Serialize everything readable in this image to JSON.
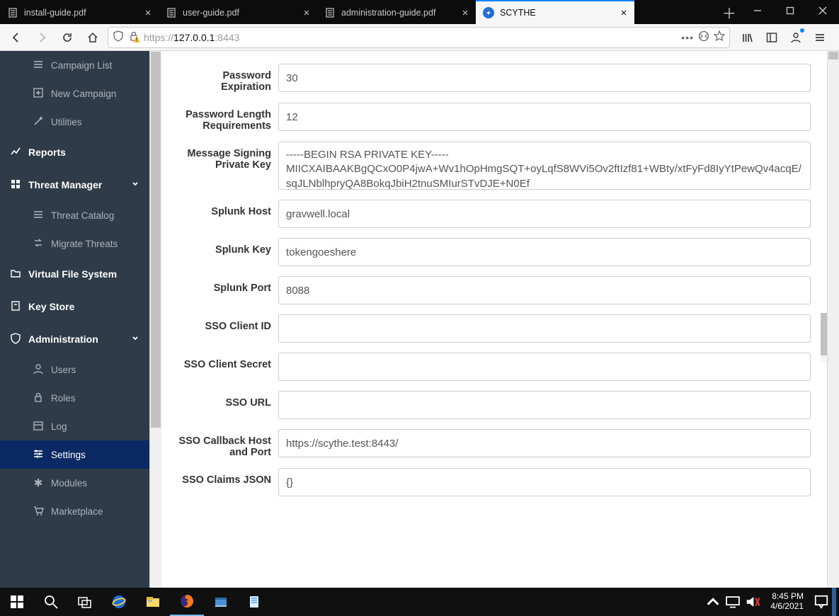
{
  "browser": {
    "tabs": [
      {
        "label": "install-guide.pdf",
        "active": false,
        "favicon": "pdf"
      },
      {
        "label": "user-guide.pdf",
        "active": false,
        "favicon": "pdf"
      },
      {
        "label": "administration-guide.pdf",
        "active": false,
        "favicon": "pdf"
      },
      {
        "label": "SCYTHE",
        "active": true,
        "favicon": "scythe"
      }
    ],
    "url": {
      "scheme": "https://",
      "host": "127.0.0.1",
      "port": ":8443"
    }
  },
  "sidebar": {
    "groups": [
      {
        "type": "sub",
        "icon": "list",
        "label": "Campaign List",
        "name": "sidebar-item-campaign-list"
      },
      {
        "type": "sub",
        "icon": "plus",
        "label": "New Campaign",
        "name": "sidebar-item-new-campaign"
      },
      {
        "type": "sub",
        "icon": "wand",
        "label": "Utilities",
        "name": "sidebar-item-utilities"
      },
      {
        "type": "header",
        "icon": "chart",
        "label": "Reports",
        "name": "sidebar-item-reports"
      },
      {
        "type": "header",
        "icon": "grid",
        "label": "Threat Manager",
        "name": "sidebar-item-threat-manager",
        "chevron": true
      },
      {
        "type": "sub",
        "icon": "list",
        "label": "Threat Catalog",
        "name": "sidebar-item-threat-catalog"
      },
      {
        "type": "sub",
        "icon": "swap",
        "label": "Migrate Threats",
        "name": "sidebar-item-migrate-threats"
      },
      {
        "type": "header",
        "icon": "folder",
        "label": "Virtual File System",
        "name": "sidebar-item-vfs"
      },
      {
        "type": "header",
        "icon": "box",
        "label": "Key Store",
        "name": "sidebar-item-keystore"
      },
      {
        "type": "header",
        "icon": "shield",
        "label": "Administration",
        "name": "sidebar-item-administration",
        "chevron": true
      },
      {
        "type": "sub",
        "icon": "user",
        "label": "Users",
        "name": "sidebar-item-users"
      },
      {
        "type": "sub",
        "icon": "lock",
        "label": "Roles",
        "name": "sidebar-item-roles"
      },
      {
        "type": "sub",
        "icon": "calendar",
        "label": "Log",
        "name": "sidebar-item-log"
      },
      {
        "type": "sub",
        "icon": "sliders",
        "label": "Settings",
        "name": "sidebar-item-settings",
        "active": true
      },
      {
        "type": "sub",
        "icon": "gear",
        "label": "Modules",
        "name": "sidebar-item-modules"
      },
      {
        "type": "sub",
        "icon": "cart",
        "label": "Marketplace",
        "name": "sidebar-item-marketplace"
      }
    ]
  },
  "form": {
    "fields": [
      {
        "label": "Password Expiration",
        "ctrl": "input",
        "value": "30",
        "name": "password-expiration-field"
      },
      {
        "label": "Password Length Requirements",
        "ctrl": "input",
        "value": "12",
        "name": "password-length-field"
      },
      {
        "label": "Message Signing Private Key",
        "ctrl": "textarea",
        "value": "-----BEGIN RSA PRIVATE KEY-----\nMIICXAIBAAKBgQCxO0P4jwA+Wv1hOpHmgSQT+oyLqfS8WVi5Ov2ftIzf81+WBty/xtFyFd8IyYtPewQv4acqE/sqJLNblhpryQA8BokqJbiH2tnuSMIurSTvDJE+N0Ef",
        "name": "private-key-field"
      },
      {
        "label": "Splunk Host",
        "ctrl": "input",
        "value": "gravwell.local",
        "name": "splunk-host-field"
      },
      {
        "label": "Splunk Key",
        "ctrl": "input",
        "value": "tokengoeshere",
        "name": "splunk-key-field"
      },
      {
        "label": "Splunk Port",
        "ctrl": "input",
        "value": "8088",
        "name": "splunk-port-field"
      },
      {
        "label": "SSO Client ID",
        "ctrl": "input",
        "value": "",
        "name": "sso-client-id-field"
      },
      {
        "label": "SSO Client Secret",
        "ctrl": "input",
        "value": "",
        "name": "sso-client-secret-field"
      },
      {
        "label": "SSO URL",
        "ctrl": "input",
        "value": "",
        "name": "sso-url-field"
      },
      {
        "label": "SSO Callback Host and Port",
        "ctrl": "input",
        "value": "https://scythe.test:8443/",
        "name": "sso-callback-field"
      },
      {
        "label": "SSO Claims JSON",
        "ctrl": "input",
        "value": "{}",
        "name": "sso-claims-json-field"
      }
    ]
  },
  "taskbar": {
    "time": "8:45 PM",
    "date": "4/6/2021"
  }
}
